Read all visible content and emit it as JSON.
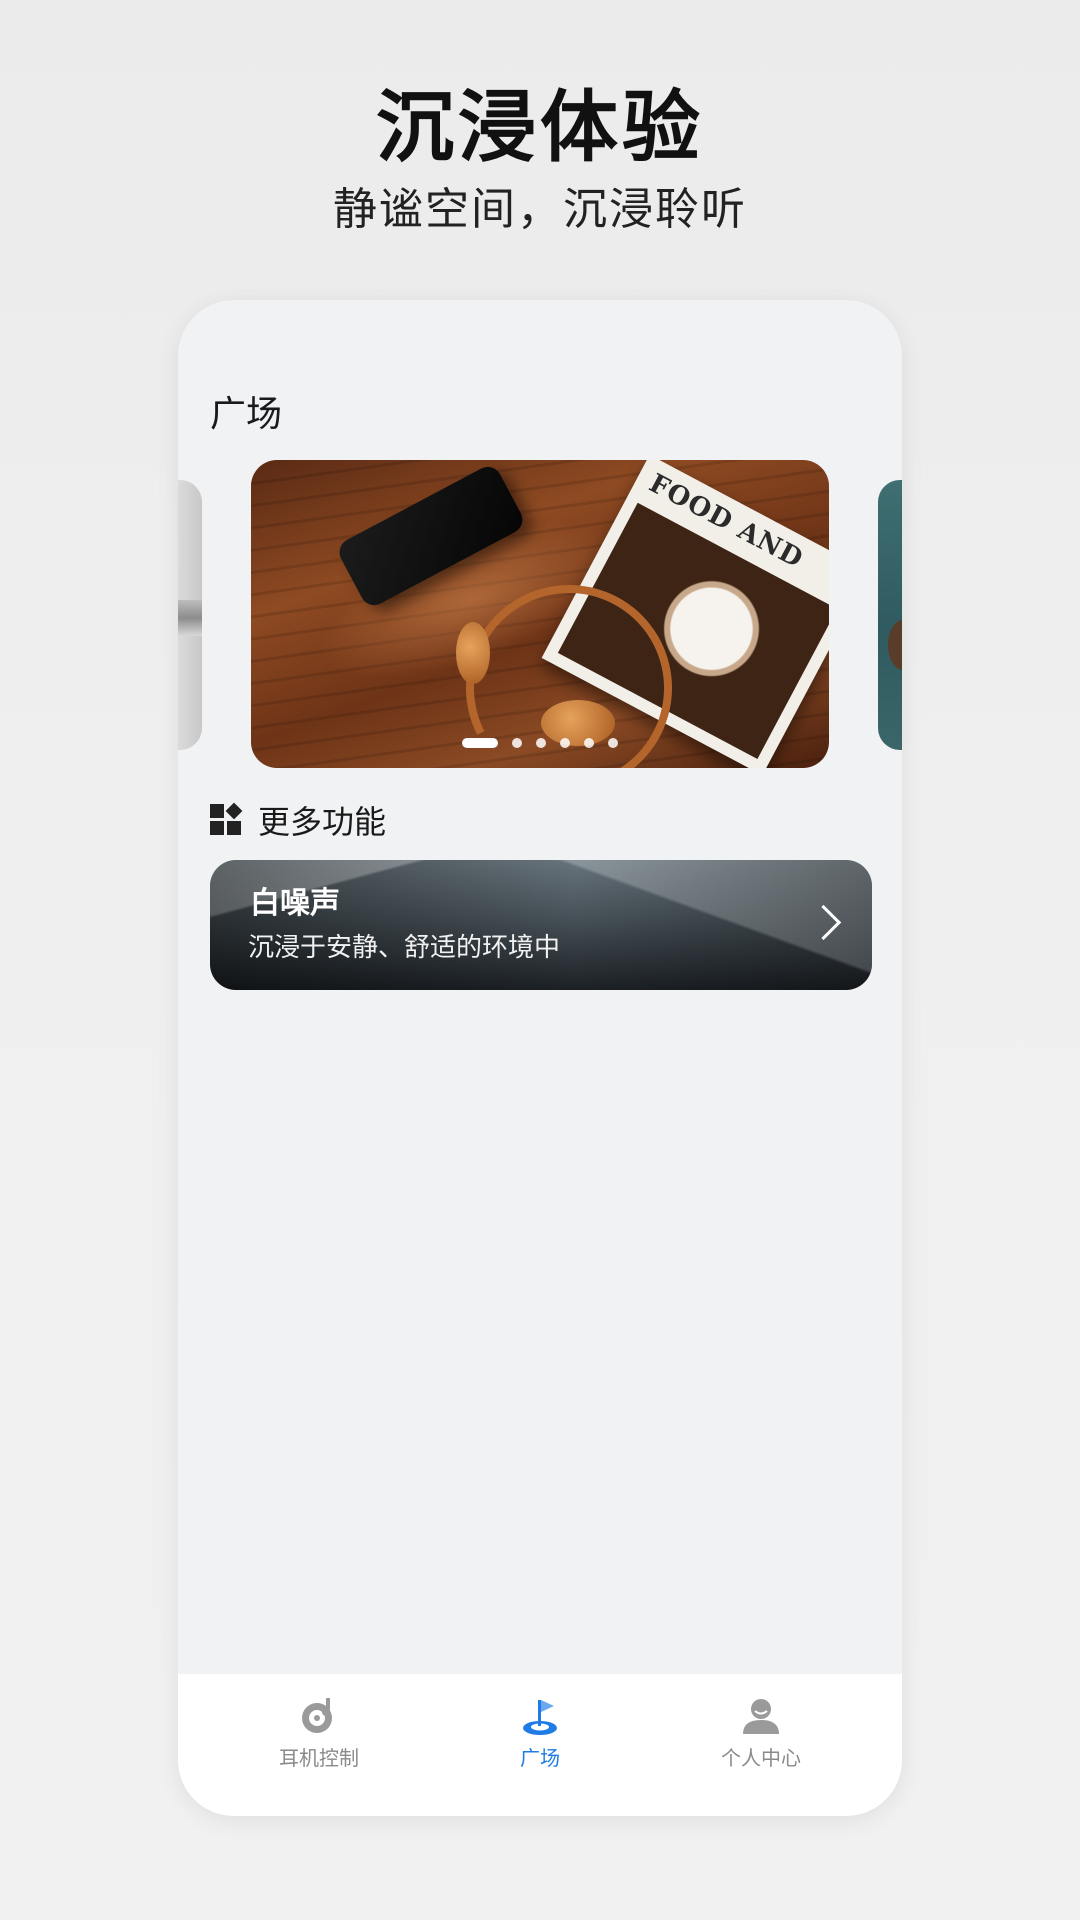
{
  "hero": {
    "title": "沉浸体验",
    "subtitle": "静谧空间，沉浸聆听"
  },
  "plaza": {
    "section_title": "广场",
    "banner": {
      "magazine_text": "FOOD AND",
      "page_count": 6,
      "active_page": 1
    },
    "more_label": "更多功能",
    "feature": {
      "title": "白噪声",
      "description": "沉浸于安静、舒适的环境中",
      "icon": "chevron-right-icon"
    }
  },
  "tabbar": {
    "items": [
      {
        "label": "耳机控制",
        "icon": "headphone-disc-icon",
        "active": false
      },
      {
        "label": "广场",
        "icon": "flag-icon",
        "active": true
      },
      {
        "label": "个人中心",
        "icon": "person-icon",
        "active": false
      }
    ]
  },
  "colors": {
    "accent": "#1f7be6",
    "inactive": "#8a8a8a",
    "text": "#1a1a1a"
  }
}
